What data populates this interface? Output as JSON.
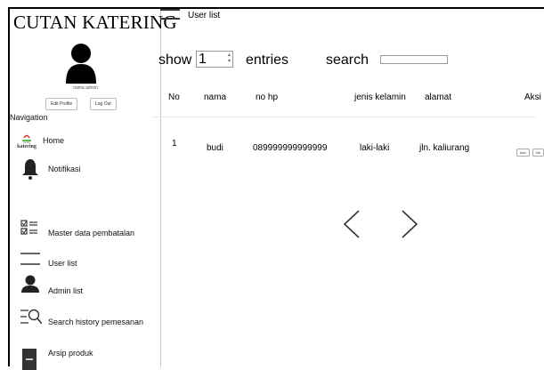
{
  "app": {
    "title": "CUTAN KATERING"
  },
  "profile": {
    "name": "nama admin",
    "edit_label": "Edit Profile",
    "logout_label": "Log Out"
  },
  "nav": {
    "heading": "Navigation",
    "items": [
      {
        "label": "Home",
        "icon": "katering-logo-icon"
      },
      {
        "label": "Notifikasi",
        "icon": "bell-icon"
      },
      {
        "label": "Master data pembatalan",
        "icon": "checklist-icon"
      },
      {
        "label": "User list",
        "icon": "hamburger-icon"
      },
      {
        "label": "Admin list",
        "icon": "user-icon"
      },
      {
        "label": "Search history pemesanan",
        "icon": "search-list-icon"
      },
      {
        "label": "Arsip produk",
        "icon": "archive-icon"
      }
    ]
  },
  "header": {
    "page_title": "User list"
  },
  "controls": {
    "show_label": "show",
    "entries_value": "1",
    "entries_label": "entries",
    "search_label": "search",
    "search_value": ""
  },
  "table": {
    "columns": [
      "No",
      "nama",
      "no hp",
      "jenis kelamin",
      "alamat",
      "Aksi"
    ],
    "rows": [
      {
        "no": "1",
        "nama": "budi",
        "no_hp": "089999999999999",
        "jenis_kelamin": "laki-laki",
        "alamat": "jln. kaliurang",
        "actions": [
          "ban",
          "De"
        ]
      }
    ]
  },
  "pagination": {
    "prev": "<",
    "next": ">"
  }
}
